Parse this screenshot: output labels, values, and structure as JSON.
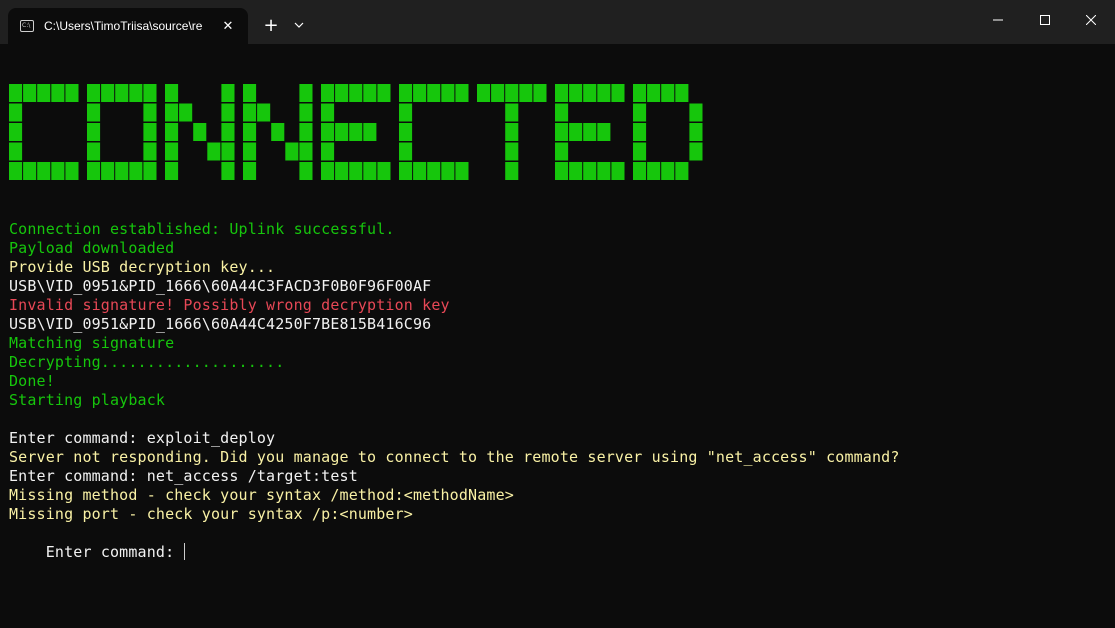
{
  "window": {
    "tab_title": "C:\\Users\\TimoTriisa\\source\\re",
    "tab_close_icon": "close-icon",
    "new_tab_icon": "plus-icon",
    "dropdown_icon": "chevron-down-icon",
    "minimize_icon": "minimize-icon",
    "maximize_icon": "maximize-icon",
    "close_icon": "close-icon"
  },
  "banner": {
    "text": "CONNECTED",
    "color": "#16c60c"
  },
  "colors": {
    "green": "#16c60c",
    "yellow": "#f9f1a5",
    "white": "#f2f2f2",
    "red": "#e74856"
  },
  "terminal": {
    "lines": [
      {
        "text": "Connection established: Uplink successful.",
        "color": "green"
      },
      {
        "text": "Payload downloaded",
        "color": "green"
      },
      {
        "text": "Provide USB decryption key...",
        "color": "yellow"
      },
      {
        "text": "USB\\VID_0951&PID_1666\\60A44C3FACD3F0B0F96F00AF",
        "color": "white"
      },
      {
        "text": "Invalid signature! Possibly wrong decryption key",
        "color": "red"
      },
      {
        "text": "USB\\VID_0951&PID_1666\\60A44C4250F7BE815B416C96",
        "color": "white"
      },
      {
        "text": "Matching signature",
        "color": "green"
      },
      {
        "text": "Decrypting....................",
        "color": "green"
      },
      {
        "text": "Done!",
        "color": "green"
      },
      {
        "text": "Starting playback",
        "color": "green"
      },
      {
        "text": "",
        "color": "white"
      },
      {
        "text": "Enter command: exploit_deploy",
        "color": "white"
      },
      {
        "text": "Server not responding. Did you manage to connect to the remote server using \"net_access\" command?",
        "color": "yellow"
      },
      {
        "text": "Enter command: net_access /target:test",
        "color": "white"
      },
      {
        "text": "Missing method - check your syntax /method:<methodName>",
        "color": "yellow"
      },
      {
        "text": "Missing port - check your syntax /p:<number>",
        "color": "yellow"
      }
    ],
    "prompt": "Enter command: "
  }
}
